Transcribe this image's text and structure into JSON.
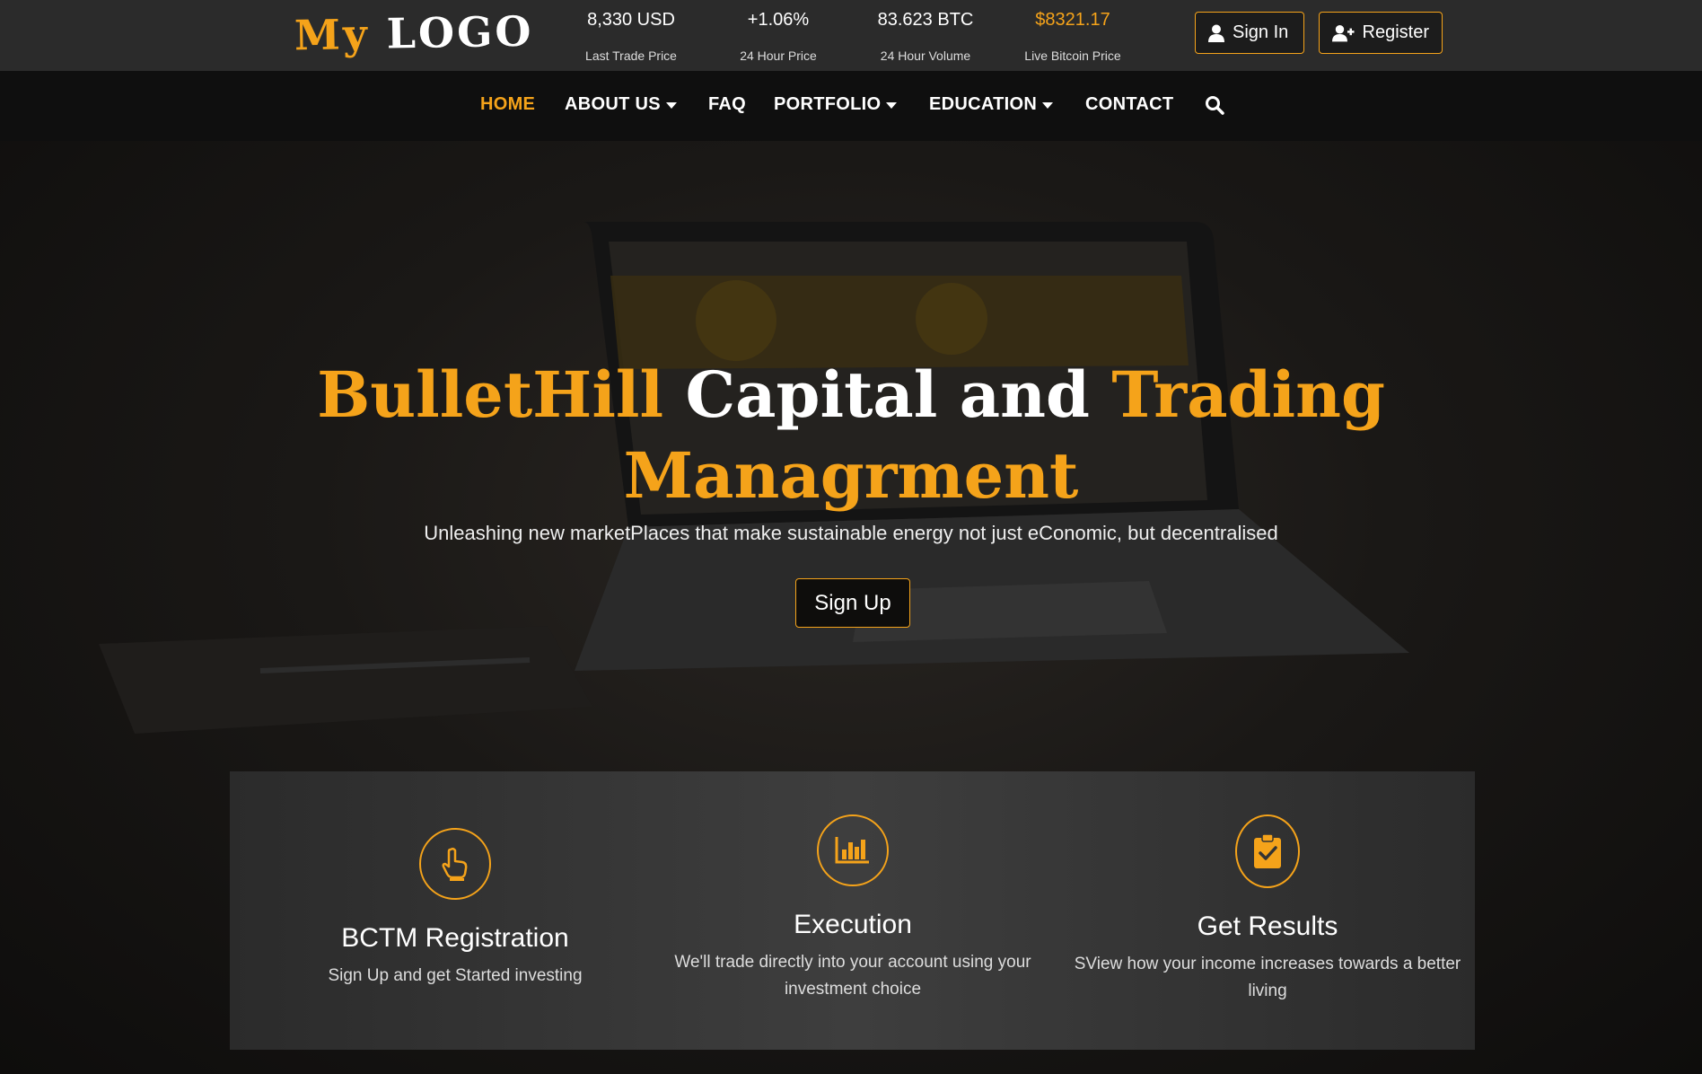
{
  "logo": {
    "part1": "My",
    "part2": "LOGO"
  },
  "ticker": [
    {
      "value": "8,330 USD",
      "label": "Last Trade Price"
    },
    {
      "value": "+1.06%",
      "label": "24 Hour Price"
    },
    {
      "value": "83.623 BTC",
      "label": "24 Hour Volume"
    },
    {
      "value": "$8321.17",
      "label": "Live Bitcoin Price"
    }
  ],
  "auth": {
    "signin": "Sign In",
    "register": "Register"
  },
  "nav": {
    "home": "HOME",
    "about": "ABOUT US",
    "faq": "FAQ",
    "portfolio": "PORTFOLIO",
    "education": "EDUCATION",
    "contact": "CONTACT"
  },
  "hero": {
    "title_w1": "BulletHill",
    "title_w2": "Capital and",
    "title_w3": "Trading",
    "title_w4": "Managrment",
    "subtitle": "Unleashing new marketPlaces that make sustainable energy not just eConomic, but decentralised",
    "cta": "Sign Up"
  },
  "features": [
    {
      "icon": "pointer-hand-icon",
      "title": "BCTM Registration",
      "desc": "Sign Up and get Started investing"
    },
    {
      "icon": "bar-chart-icon",
      "title": "Execution",
      "desc": "We'll trade directly into your account using your investment choice"
    },
    {
      "icon": "clipboard-check-icon",
      "title": "Get Results",
      "desc": "SView how your income increases towards a better living"
    }
  ],
  "colors": {
    "accent": "#f5a31a",
    "topbar": "#2b2b2b",
    "navbar": "#0f0f0f"
  }
}
